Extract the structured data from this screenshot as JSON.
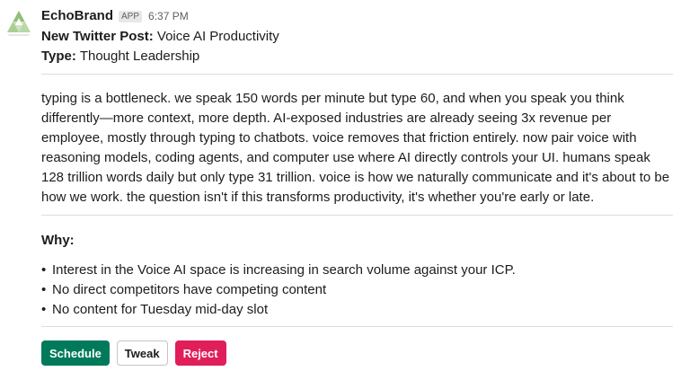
{
  "message": {
    "sender": "EchoBrand",
    "app_badge": "APP",
    "time": "6:37 PM",
    "post_label": "New Twitter Post:",
    "post_title": "Voice AI Productivity",
    "type_label": "Type:",
    "type_value": "Thought Leadership",
    "body": "typing is a bottleneck. we speak 150 words per minute but type 60, and when you speak you think differently—more context, more depth. AI-exposed industries are already seeing 3x revenue per employee, mostly through typing to chatbots. voice removes that friction entirely. now pair voice with reasoning models, coding agents, and computer use where AI directly controls your UI. humans speak 128 trillion words daily but only type 31 trillion. voice is how we naturally communicate and it's about to be how we work. the question isn't if this transforms productivity, it's whether you're early or late.",
    "why_label": "Why:",
    "bullet_char": "•",
    "reasons": [
      "Interest in the Voice AI space is increasing in search volume against your ICP.",
      "No direct competitors have competing content",
      "No content for Tuesday mid-day slot"
    ]
  },
  "actions": {
    "schedule_label": "Schedule",
    "tweak_label": "Tweak",
    "reject_label": "Reject"
  },
  "colors": {
    "schedule": "#007a5a",
    "reject": "#e01e5a",
    "divider": "#dddddd"
  },
  "icons": {
    "avatar": "echobrand-logo-icon"
  }
}
